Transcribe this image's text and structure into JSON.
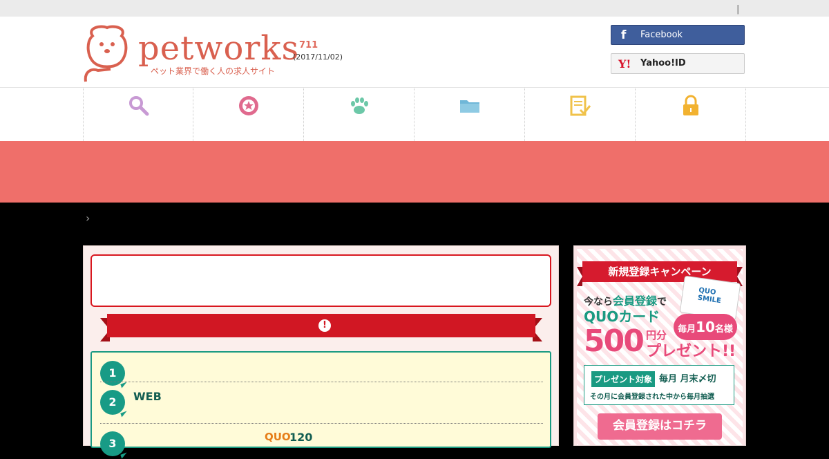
{
  "topbar": {
    "separator": "|"
  },
  "header": {
    "logo_text": "petworks",
    "logo_tagline": "ペット業界で働く人の求人サイト",
    "count": "711",
    "date": "(2017/11/02)"
  },
  "login": {
    "facebook_label": "Facebook",
    "facebook_icon": "f",
    "yahoo_label": "Yahoo!ID",
    "yahoo_icon": "Y!"
  },
  "nav": {
    "items": [
      {
        "icon": "search-icon",
        "color": "#c89ad4"
      },
      {
        "icon": "star-badge-icon",
        "color": "#e06a8e"
      },
      {
        "icon": "paw-icon",
        "color": "#6cc8a8"
      },
      {
        "icon": "folder-icon",
        "color": "#6fb7d8"
      },
      {
        "icon": "checklist-icon",
        "color": "#f0c24a"
      },
      {
        "icon": "lock-icon",
        "color": "#f2b230"
      }
    ]
  },
  "breadcrumb": {
    "chevron": "›"
  },
  "main": {
    "ribbon_icon": "!",
    "steps": [
      {
        "number": "1",
        "text": ""
      },
      {
        "number": "2",
        "text": "WEB"
      },
      {
        "number": "3",
        "prefix": "QUO",
        "suffix": "120"
      }
    ]
  },
  "sidebar_promo": {
    "banner": "新規登録キャンペーン",
    "line1_pre": "今なら",
    "line1_highlight": "会員登録",
    "line1_post": "で",
    "line2": "QUOカード",
    "card_label": "QUO SMILE",
    "amount": "500",
    "amount_unit": "円分",
    "present": "プレゼント!!",
    "monthly_pre": "毎月",
    "monthly_number": "10",
    "monthly_post": "名様",
    "target_label": "プレゼント対象",
    "deadline": "毎月 月末〆切",
    "note": "その月に会員登録された中から毎月抽選",
    "cta": "会員登録はコチラ"
  },
  "colors": {
    "accent": "#ef6f6a",
    "red": "#d11723",
    "teal": "#1a9a82",
    "facebook": "#3f5e9c"
  }
}
